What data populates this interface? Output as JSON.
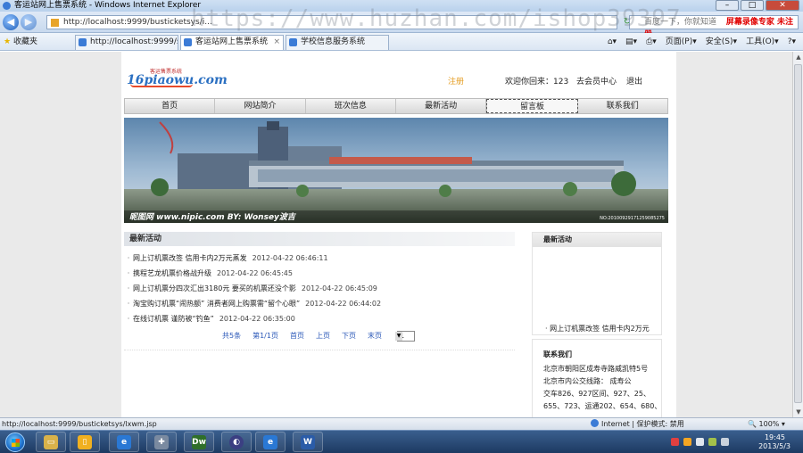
{
  "browser": {
    "window_title": "客运站网上售票系统 - Windows Internet Explorer",
    "url": "http://localhost:9999/busticketsys/i...",
    "search_hint": "百度一下，你就知道",
    "watermark": "https://www.huzhan.com/ishop39397",
    "searchbox_overlay": "屏幕录像专家  未注册",
    "favorites_label": "收藏夹",
    "tabs": [
      {
        "label": "http://localhost:9999/sc..."
      },
      {
        "label": "客运站网上售票系统"
      },
      {
        "label": "学校信息服务系统"
      }
    ],
    "tools": {
      "page": "页面(P)",
      "safety": "安全(S)",
      "tools": "工具(O)"
    },
    "status_url": "http://localhost:9999/busticketsys/lxwm.jsp",
    "status_zone": "Internet | 保护模式: 禁用",
    "zoom": "100%"
  },
  "site": {
    "logo_text": "16piaowu.com",
    "logo_small": "客运售票系统",
    "register": "注册",
    "welcome": "欢迎你回来：123",
    "member_center": "去会员中心",
    "logout": "退出",
    "nav": [
      "首页",
      "网站简介",
      "班次信息",
      "最新活动",
      "留言板",
      "联系我们"
    ],
    "banner_caption": "昵图网  www.nipic.com     BY: Wonsey波吉",
    "banner_code": "NO:20100929171259085275"
  },
  "latest": {
    "title": "最新活动",
    "items": [
      {
        "text": "网上订机票改签 信用卡内2万元蒸发",
        "date": "2012-04-22 06:46:11"
      },
      {
        "text": "携程艺龙机票价格战升级",
        "date": "2012-04-22 06:45:45"
      },
      {
        "text": "网上订机票分四次汇出3180元 要买的机票还没个影",
        "date": "2012-04-22 06:45:09"
      },
      {
        "text": "淘宝购订机票“闹热额” 消费者网上购票需“留个心眼”",
        "date": "2012-04-22 06:44:02"
      },
      {
        "text": "在线订机票 谨防被“钓鱼”",
        "date": "2012-04-22 06:35:00"
      }
    ],
    "pager": {
      "total": "共5条",
      "page": "第1/1页",
      "first": "首页",
      "prev": "上页",
      "next": "下页",
      "last": "末页",
      "select": "1"
    }
  },
  "sidebar": {
    "latest_title": "最新活动",
    "latest_item": "网上订机票改签 信用卡内2万元",
    "contact_title": "联系我们",
    "contact_lines": [
      "北京市朝阳区成寿寺路威凯特5号",
      "北京市内公交线路：      成寿公",
      "交车826、927区间、927、25、",
      "655、723、运通202、654、680、"
    ]
  },
  "taskbar": {
    "time": "19:45",
    "date": "2013/5/3"
  }
}
